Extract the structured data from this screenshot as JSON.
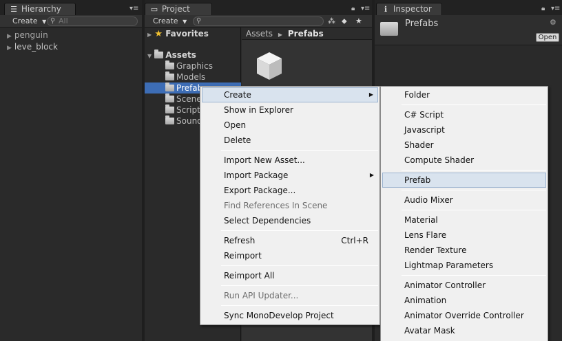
{
  "hierarchy": {
    "tab_title": "Hierarchy",
    "create_label": "Create",
    "search_placeholder": "All",
    "items": [
      "penguin",
      "leve_block"
    ]
  },
  "project": {
    "tab_title": "Project",
    "create_label": "Create",
    "favorites_label": "Favorites",
    "assets_label": "Assets",
    "folders": [
      "Graphics",
      "Models",
      "Prefabs",
      "Scenes",
      "Scripts",
      "Sounds"
    ],
    "breadcrumb": [
      "Assets",
      "Prefabs"
    ]
  },
  "inspector": {
    "tab_title": "Inspector",
    "folder_name": "Prefabs",
    "open_label": "Open"
  },
  "context_menu": {
    "items": [
      {
        "label": "Create",
        "submenu": true,
        "highlighted": true
      },
      {
        "label": "Show in Explorer"
      },
      {
        "label": "Open"
      },
      {
        "label": "Delete"
      },
      {
        "label": "Import New Asset..."
      },
      {
        "label": "Import Package",
        "submenu": true
      },
      {
        "label": "Export Package..."
      },
      {
        "label": "Find References In Scene",
        "disabled": true
      },
      {
        "label": "Select Dependencies"
      },
      {
        "label": "Refresh",
        "shortcut": "Ctrl+R"
      },
      {
        "label": "Reimport"
      },
      {
        "label": "Reimport All"
      },
      {
        "label": "Run API Updater...",
        "disabled": true
      },
      {
        "label": "Sync MonoDevelop Project"
      }
    ]
  },
  "create_submenu": {
    "items": [
      {
        "label": "Folder"
      },
      {
        "label": "C# Script"
      },
      {
        "label": "Javascript"
      },
      {
        "label": "Shader"
      },
      {
        "label": "Compute Shader"
      },
      {
        "label": "Prefab",
        "highlighted": true
      },
      {
        "label": "Audio Mixer"
      },
      {
        "label": "Material"
      },
      {
        "label": "Lens Flare"
      },
      {
        "label": "Render Texture"
      },
      {
        "label": "Lightmap Parameters"
      },
      {
        "label": "Animator Controller"
      },
      {
        "label": "Animation"
      },
      {
        "label": "Animator Override Controller"
      },
      {
        "label": "Avatar Mask"
      }
    ]
  }
}
